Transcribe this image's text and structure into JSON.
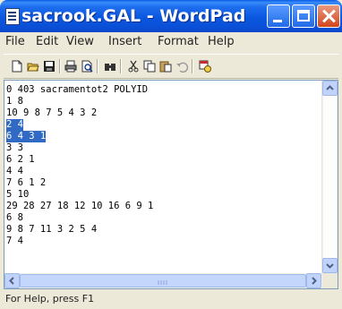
{
  "window": {
    "title": "sacrook.GAL - WordPad"
  },
  "menu": [
    "File",
    "Edit",
    "View",
    "Insert",
    "Format",
    "Help"
  ],
  "toolbar": {
    "icons": [
      "new-document-icon",
      "open-folder-icon",
      "save-icon",
      "print-icon",
      "print-preview-icon",
      "find-icon",
      "cut-icon",
      "copy-icon",
      "paste-icon",
      "undo-icon",
      "insert-datetime-icon"
    ]
  },
  "document": {
    "lines": [
      "0 403 sacramentot2 POLYID",
      "1 8",
      "10 9 8 7 5 4 3 2",
      "2 4",
      "6 4 3 1",
      "3 3",
      "6 2 1",
      "4 4",
      "7 6 1 2",
      "5 10",
      "29 28 27 18 12 10 16 6 9 1",
      "6 8",
      "9 8 7 11 3 2 5 4",
      "7 4"
    ],
    "selected_lines": [
      3,
      4
    ],
    "selection_color": "#316ac5"
  },
  "status": {
    "text": "For Help, press F1"
  }
}
